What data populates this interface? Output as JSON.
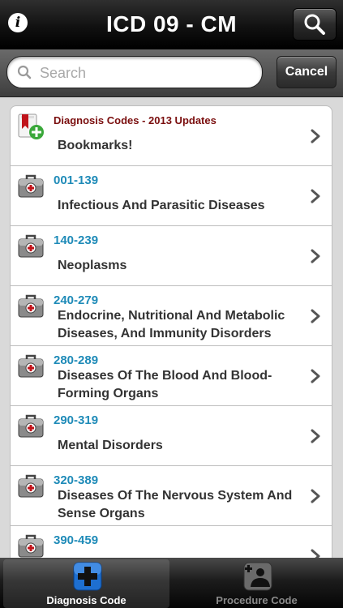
{
  "navbar": {
    "title": "ICD 09 - CM",
    "info_icon": "info-icon",
    "search_icon": "search-icon"
  },
  "search": {
    "placeholder": "Search",
    "value": "",
    "cancel_label": "Cancel"
  },
  "list": {
    "items": [
      {
        "code": "Diagnosis Codes -  2013 Updates",
        "title": "Bookmarks!",
        "icon": "bookmark-add-icon"
      },
      {
        "code": "001-139",
        "title": "Infectious And Parasitic Diseases",
        "icon": "medical-bag-icon"
      },
      {
        "code": "140-239",
        "title": "Neoplasms",
        "icon": "medical-bag-icon"
      },
      {
        "code": "240-279",
        "title": "Endocrine, Nutritional And Metabolic Diseases, And Immunity Disorders",
        "icon": "medical-bag-icon"
      },
      {
        "code": "280-289",
        "title": "Diseases Of The Blood And Blood-Forming Organs",
        "icon": "medical-bag-icon"
      },
      {
        "code": "290-319",
        "title": "Mental Disorders",
        "icon": "medical-bag-icon"
      },
      {
        "code": "320-389",
        "title": "Diseases Of The Nervous System And Sense Organs",
        "icon": "medical-bag-icon"
      },
      {
        "code": "390-459",
        "title": "",
        "icon": "medical-bag-icon"
      }
    ]
  },
  "tabs": [
    {
      "label": "Diagnosis Code",
      "icon": "medical-cross-icon",
      "active": true
    },
    {
      "label": "Procedure Code",
      "icon": "patient-procedure-icon",
      "active": false
    }
  ],
  "colors": {
    "code_blue": "#1f8bb8",
    "updates_red": "#7a0e0e",
    "cross_blue": "#1e6fd0"
  }
}
